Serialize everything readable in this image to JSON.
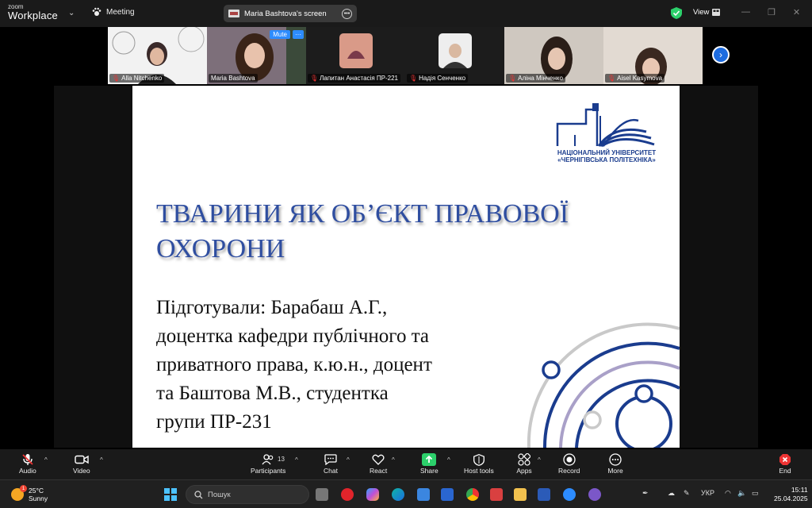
{
  "app": {
    "logo_line1": "zoom",
    "logo_line2": "Workplace",
    "meeting_label": "Meeting",
    "screen_share_label": "Maria Bashtova's screen",
    "view_label": "View"
  },
  "participants": [
    {
      "name": "Alla Nitchenko",
      "muted": true
    },
    {
      "name": "Maria Bashtova",
      "muted": false,
      "active": true
    },
    {
      "name": "Лапитан Анастасія ПР-221",
      "muted": true
    },
    {
      "name": "Надія Сенченко",
      "muted": true
    },
    {
      "name": "Аліна Мінченко",
      "muted": true
    },
    {
      "name": "Aisel Kasymova",
      "muted": true
    }
  ],
  "active_tile": {
    "mute_label": "Mute",
    "more_label": "···"
  },
  "slide": {
    "title_line1": "ТВАРИНИ ЯК ОБ’ЄКТ ПРАВОВОЇ",
    "title_line2": "ОХОРОНИ",
    "body_lines": [
      "Підготували: Барабаш А.Г.,",
      "доцентка кафедри публічного та",
      "приватного права, к.ю.н., доцент",
      "та Баштова М.В., студентка",
      "групи ПР-231"
    ],
    "university_line1": "НАЦІОНАЛЬНИЙ УНІВЕРСИТЕТ",
    "university_line2": "«ЧЕРНІГІВСЬКА ПОЛІТЕХНІКА»"
  },
  "toolbar": {
    "audio": "Audio",
    "video": "Video",
    "participants": "Participants",
    "participants_count": "13",
    "chat": "Chat",
    "react": "React",
    "share": "Share",
    "host_tools": "Host tools",
    "apps": "Apps",
    "record": "Record",
    "more": "More",
    "end": "End"
  },
  "taskbar": {
    "temperature": "25°C",
    "weather": "Sunny",
    "weather_badge": "1",
    "search_placeholder": "Пошук",
    "language": "УКР",
    "time": "15:11",
    "date": "25.04.2025"
  },
  "colors": {
    "accent_blue": "#2d8cff",
    "active_green": "#2cd06b",
    "slide_title": "#2f4ea0",
    "university_blue": "#1a3c8e"
  }
}
